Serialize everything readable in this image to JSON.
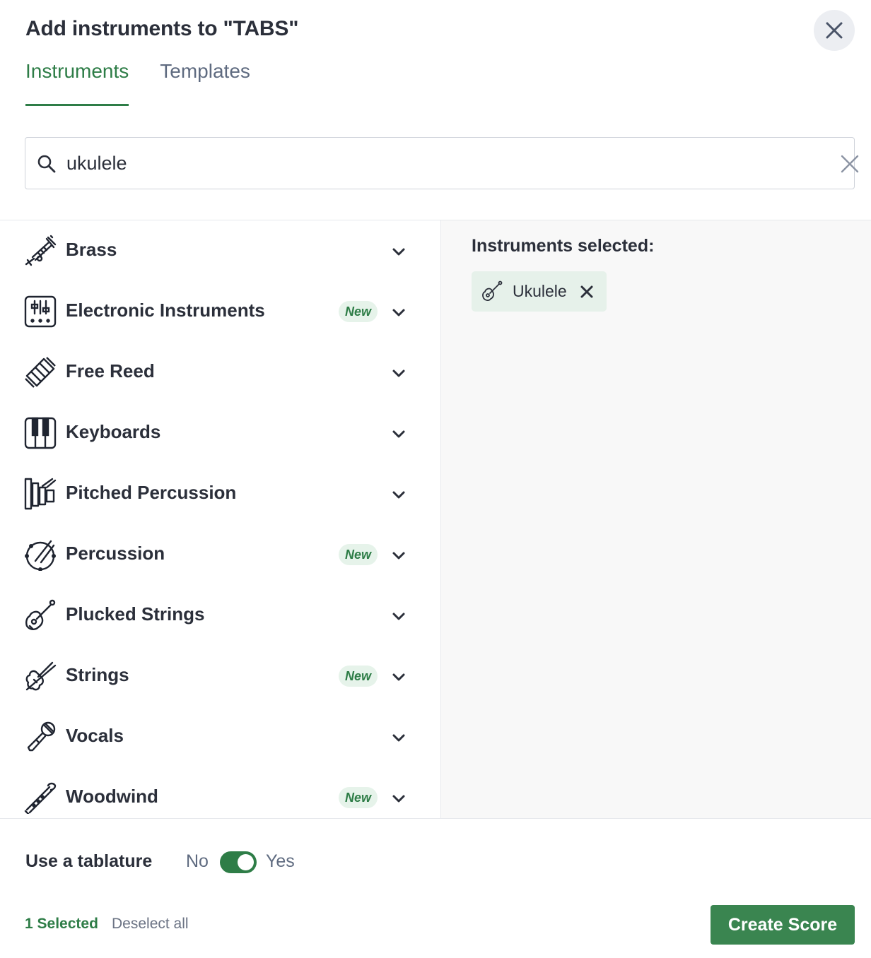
{
  "dialog": {
    "title": "Add instruments to \"TABS\"",
    "tabs": [
      {
        "label": "Instruments",
        "active": true
      },
      {
        "label": "Templates",
        "active": false
      }
    ]
  },
  "search": {
    "value": "ukulele",
    "icon": "search-icon",
    "clear_icon": "clear-icon"
  },
  "categories": [
    {
      "label": "Brass",
      "icon": "trumpet-icon",
      "badge": ""
    },
    {
      "label": "Electronic Instruments",
      "icon": "synthesizer-icon",
      "badge": "New"
    },
    {
      "label": "Free Reed",
      "icon": "accordion-icon",
      "badge": ""
    },
    {
      "label": "Keyboards",
      "icon": "piano-keys-icon",
      "badge": ""
    },
    {
      "label": "Pitched Percussion",
      "icon": "xylophone-icon",
      "badge": ""
    },
    {
      "label": "Percussion",
      "icon": "drum-icon",
      "badge": "New"
    },
    {
      "label": "Plucked Strings",
      "icon": "guitar-icon",
      "badge": ""
    },
    {
      "label": "Strings",
      "icon": "violin-icon",
      "badge": "New"
    },
    {
      "label": "Vocals",
      "icon": "microphone-icon",
      "badge": ""
    },
    {
      "label": "Woodwind",
      "icon": "flute-icon",
      "badge": "New"
    }
  ],
  "selection": {
    "title": "Instruments selected:",
    "items": [
      {
        "label": "Ukulele",
        "icon": "ukulele-icon"
      }
    ]
  },
  "footer": {
    "tablature_label": "Use a tablature",
    "no_label": "No",
    "yes_label": "Yes",
    "tablature_on": true,
    "selected_count": "1 Selected",
    "deselect_label": "Deselect all",
    "create_label": "Create Score"
  },
  "colors": {
    "accent": "#2e7d47",
    "badge_bg": "#e6f3ea",
    "chip_bg": "#e6f1ea",
    "button_bg": "#3a8550"
  }
}
